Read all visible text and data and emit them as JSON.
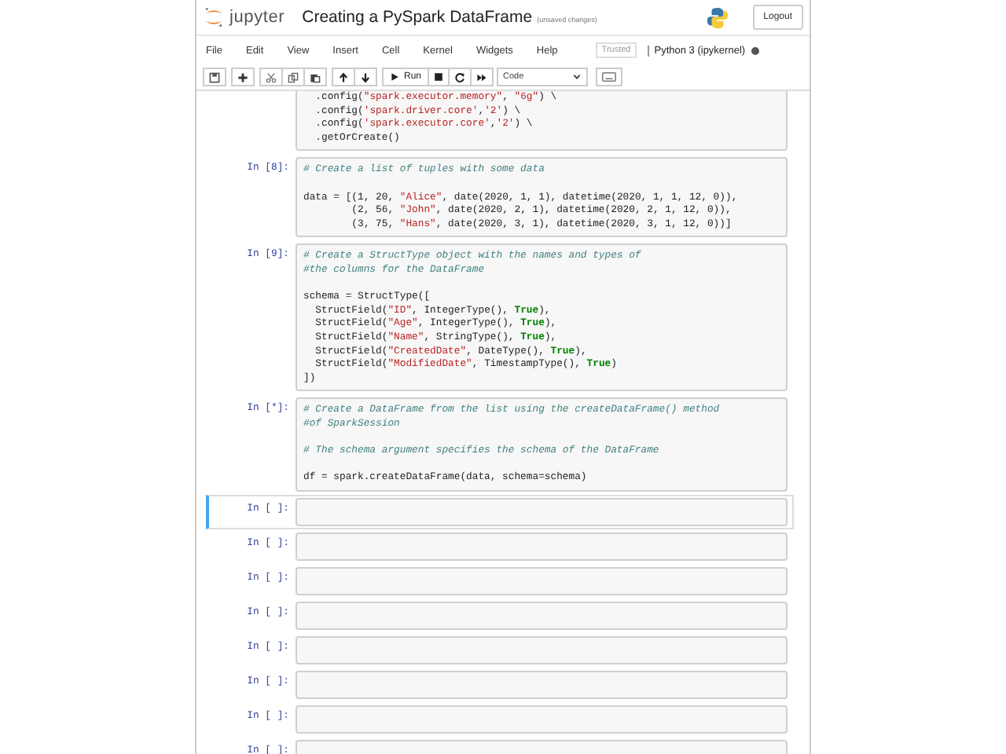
{
  "header": {
    "brand": "jupyter",
    "notebook_title": "Creating a PySpark DataFrame",
    "save_status": "(unsaved changes)",
    "logout": "Logout"
  },
  "menu": [
    "File",
    "Edit",
    "View",
    "Insert",
    "Cell",
    "Kernel",
    "Widgets",
    "Help"
  ],
  "trusted": "Trusted",
  "kernel": {
    "name": "Python 3 (ipykernel)",
    "busy": true
  },
  "toolbar": {
    "run": "Run",
    "cell_type": "Code"
  },
  "cells": [
    {
      "selected": false,
      "lines": [
        {
          "segments": [
            {
              "kind": "plain",
              "text": "  .config("
            },
            {
              "kind": "str",
              "text": "\"spark.executor.memory\""
            },
            {
              "kind": "plain",
              "text": ", "
            },
            {
              "kind": "str",
              "text": "\"6g\""
            },
            {
              "kind": "plain",
              "text": ") \\"
            }
          ]
        },
        {
          "segments": [
            {
              "kind": "plain",
              "text": "  .config("
            },
            {
              "kind": "str",
              "text": "'spark.driver.core'"
            },
            {
              "kind": "plain",
              "text": ","
            },
            {
              "kind": "str",
              "text": "'2'"
            },
            {
              "kind": "plain",
              "text": ") \\"
            }
          ]
        },
        {
          "segments": [
            {
              "kind": "plain",
              "text": "  .config("
            },
            {
              "kind": "str",
              "text": "'spark.executor.core'"
            },
            {
              "kind": "plain",
              "text": ","
            },
            {
              "kind": "str",
              "text": "'2'"
            },
            {
              "kind": "plain",
              "text": ") \\"
            }
          ]
        },
        {
          "segments": [
            {
              "kind": "plain",
              "text": "  .getOrCreate()"
            }
          ]
        }
      ]
    },
    {
      "prompt": "In [8]:",
      "selected": false,
      "lines": [
        {
          "segments": [
            {
              "kind": "comment",
              "text": "# Create a list of tuples with some data"
            }
          ]
        },
        {
          "blank_before": true,
          "segments": [
            {
              "kind": "plain",
              "text": "data = [(1, 20, "
            },
            {
              "kind": "str",
              "text": "\"Alice\""
            },
            {
              "kind": "plain",
              "text": ", date(2020, 1, 1), datetime(2020, 1, 1, 12, 0)),"
            }
          ]
        },
        {
          "segments": [
            {
              "kind": "plain",
              "text": "        (2, 56, "
            },
            {
              "kind": "str",
              "text": "\"John\""
            },
            {
              "kind": "plain",
              "text": ", date(2020, 2, 1), datetime(2020, 2, 1, 12, 0)),"
            }
          ]
        },
        {
          "segments": [
            {
              "kind": "plain",
              "text": "        (3, 75, "
            },
            {
              "kind": "str",
              "text": "\"Hans\""
            },
            {
              "kind": "plain",
              "text": ", date(2020, 3, 1), datetime(2020, 3, 1, 12, 0))]"
            }
          ]
        }
      ]
    },
    {
      "prompt": "In [9]:",
      "selected": false,
      "lines": [
        {
          "segments": [
            {
              "kind": "comment",
              "text": "# Create a StructType object with the names and types of"
            }
          ]
        },
        {
          "segments": [
            {
              "kind": "comment",
              "text": "#the columns for the DataFrame"
            }
          ]
        },
        {
          "blank_before": true,
          "segments": [
            {
              "kind": "plain",
              "text": "schema = StructType(["
            }
          ]
        },
        {
          "segments": [
            {
              "kind": "plain",
              "text": "  StructField("
            },
            {
              "kind": "str",
              "text": "\"ID\""
            },
            {
              "kind": "plain",
              "text": ", IntegerType(), "
            },
            {
              "kind": "keyword",
              "text": "True"
            },
            {
              "kind": "plain",
              "text": "),"
            }
          ]
        },
        {
          "segments": [
            {
              "kind": "plain",
              "text": "  StructField("
            },
            {
              "kind": "str",
              "text": "\"Age\""
            },
            {
              "kind": "plain",
              "text": ", IntegerType(), "
            },
            {
              "kind": "keyword",
              "text": "True"
            },
            {
              "kind": "plain",
              "text": "),"
            }
          ]
        },
        {
          "segments": [
            {
              "kind": "plain",
              "text": "  StructField("
            },
            {
              "kind": "str",
              "text": "\"Name\""
            },
            {
              "kind": "plain",
              "text": ", StringType(), "
            },
            {
              "kind": "keyword",
              "text": "True"
            },
            {
              "kind": "plain",
              "text": "),"
            }
          ]
        },
        {
          "segments": [
            {
              "kind": "plain",
              "text": "  StructField("
            },
            {
              "kind": "str",
              "text": "\"CreatedDate\""
            },
            {
              "kind": "plain",
              "text": ", DateType(), "
            },
            {
              "kind": "keyword",
              "text": "True"
            },
            {
              "kind": "plain",
              "text": "),"
            }
          ]
        },
        {
          "segments": [
            {
              "kind": "plain",
              "text": "  StructField("
            },
            {
              "kind": "str",
              "text": "\"ModifiedDate\""
            },
            {
              "kind": "plain",
              "text": ", TimestampType(), "
            },
            {
              "kind": "keyword",
              "text": "True"
            },
            {
              "kind": "plain",
              "text": ")"
            }
          ]
        },
        {
          "segments": [
            {
              "kind": "plain",
              "text": "])"
            }
          ]
        }
      ]
    },
    {
      "prompt": "In [*]:",
      "selected": false,
      "lines": [
        {
          "segments": [
            {
              "kind": "comment",
              "text": "# Create a DataFrame from the list using the createDataFrame() method"
            }
          ]
        },
        {
          "segments": [
            {
              "kind": "comment",
              "text": "#of SparkSession"
            }
          ]
        },
        {
          "blank_before": true,
          "segments": [
            {
              "kind": "comment",
              "text": "# The schema argument specifies the schema of the DataFrame"
            }
          ]
        },
        {
          "blank_before": true,
          "segments": [
            {
              "kind": "plain",
              "text": "df = spark.createDataFrame(data, schema=schema)"
            }
          ]
        }
      ]
    },
    {
      "prompt": "In [ ]:",
      "selected": true
    },
    {
      "prompt": "In [ ]:",
      "selected": false
    },
    {
      "prompt": "In [ ]:",
      "selected": false
    },
    {
      "prompt": "In [ ]:",
      "selected": false
    },
    {
      "prompt": "In [ ]:",
      "selected": false
    },
    {
      "prompt": "In [ ]:",
      "selected": false
    },
    {
      "prompt": "In [ ]:",
      "selected": false
    },
    {
      "prompt": "In [ ]:",
      "selected": false
    }
  ]
}
